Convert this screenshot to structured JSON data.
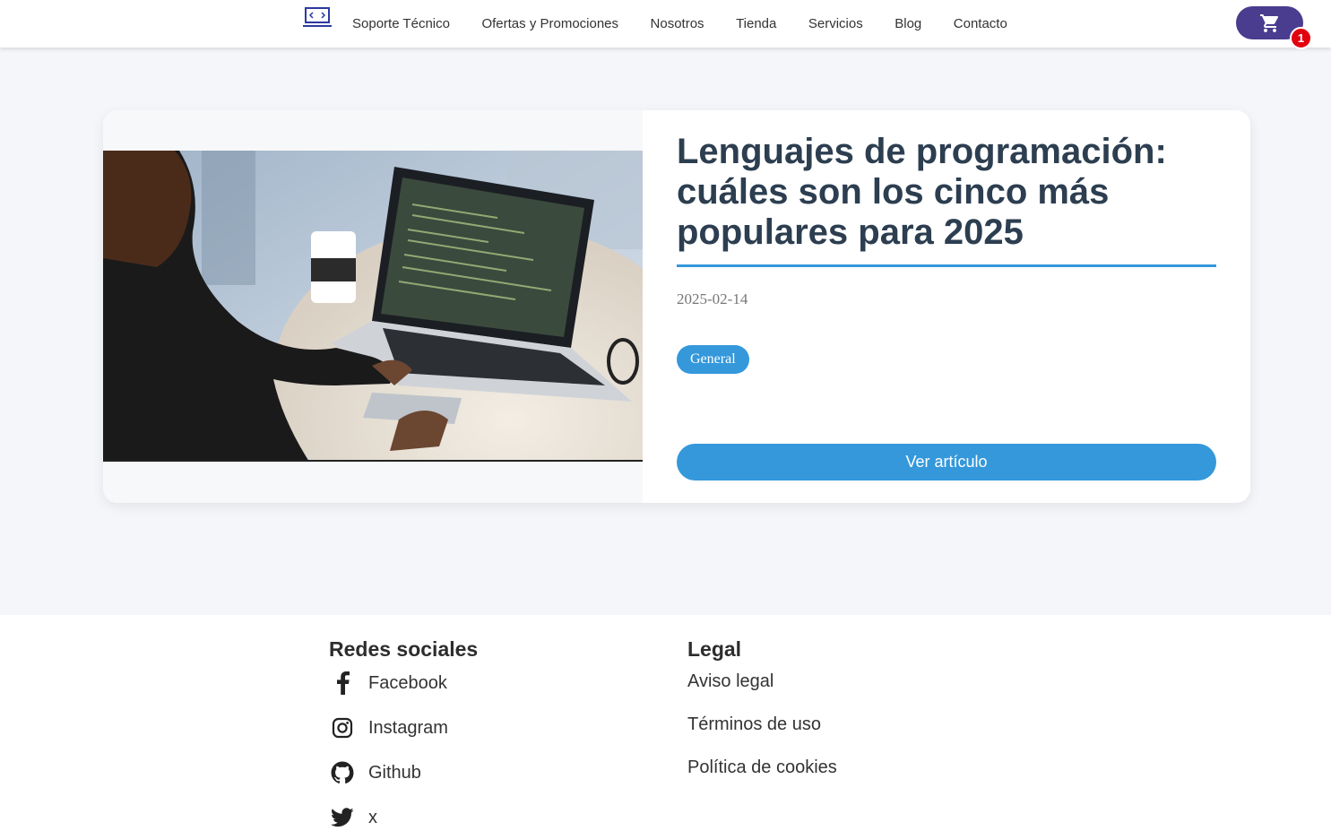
{
  "header": {
    "nav": [
      "Soporte Técnico",
      "Ofertas y Promociones",
      "Nosotros",
      "Tienda",
      "Servicios",
      "Blog",
      "Contacto"
    ],
    "cart_count": "1"
  },
  "post": {
    "title": "Lenguajes de programación: cuáles son los cinco más populares para 2025",
    "date": "2025-02-14",
    "category": "General",
    "cta": "Ver artículo"
  },
  "footer": {
    "social_title": "Redes sociales",
    "social": [
      {
        "label": "Facebook",
        "icon": "facebook-icon"
      },
      {
        "label": "Instagram",
        "icon": "instagram-icon"
      },
      {
        "label": "Github",
        "icon": "github-icon"
      },
      {
        "label": "x",
        "icon": "twitter-icon"
      }
    ],
    "legal_title": "Legal",
    "legal": [
      "Aviso legal",
      "Términos de uso",
      "Política de cookies"
    ]
  },
  "colors": {
    "accent": "#3498db",
    "cart": "#4a3d8f",
    "badge": "#e3000f",
    "title": "#2c3e50"
  }
}
